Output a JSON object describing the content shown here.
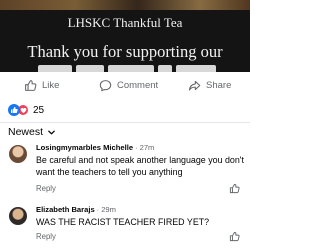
{
  "post": {
    "image": {
      "title": "LHSKC Thankful Tea",
      "headline": "Thank you for supporting our"
    },
    "actions": {
      "like": "Like",
      "comment": "Comment",
      "share": "Share"
    },
    "reactions": {
      "count": "25",
      "icons": [
        "thumbs-up-reaction",
        "heart-reaction"
      ]
    }
  },
  "comments_section": {
    "sort_label": "Newest",
    "comments": [
      {
        "author": "Losingmymarbles Michelle",
        "time": "27m",
        "text": "Be careful and not speak another language you don't want the teachers to tell you anything",
        "reply_label": "Reply"
      },
      {
        "author": "Elizabeth Barajs",
        "time": "29m",
        "text": "WAS THE RACIST TEACHER FIRED YET?",
        "reply_label": "Reply"
      }
    ]
  },
  "colors": {
    "facebook_blue": "#1877f2",
    "love_red": "#f33e58",
    "muted_text": "#65676b",
    "image_background": "#141414"
  }
}
